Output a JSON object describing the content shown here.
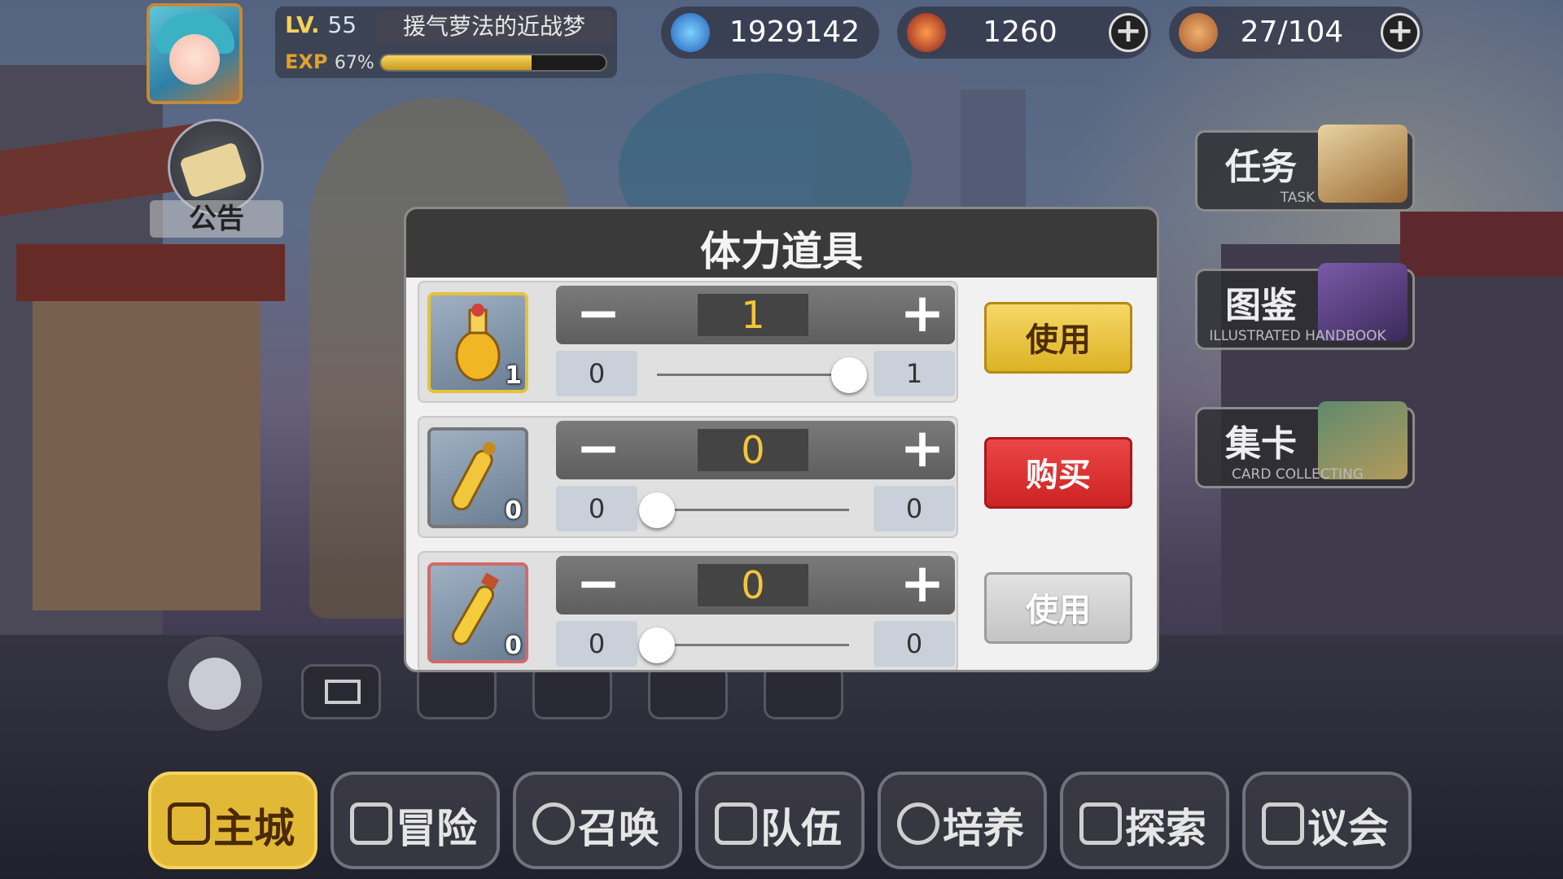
{
  "hud": {
    "level_label": "LV.",
    "level": "55",
    "player_name": "援气萝法的近战梦",
    "exp_label": "EXP",
    "exp_percent": "67%",
    "exp_progress": 0.67,
    "resources": [
      {
        "icon": "blue-flame-icon",
        "value": "1929142"
      },
      {
        "icon": "red-crystal-icon",
        "value": "1260"
      },
      {
        "icon": "bread-icon",
        "value": "27/104"
      }
    ]
  },
  "notice": {
    "label": "公告"
  },
  "side_buttons": [
    {
      "title": "任务",
      "subtitle": "TASK"
    },
    {
      "title": "图鉴",
      "subtitle": "ILLUSTRATED HANDBOOK"
    },
    {
      "title": "集卡",
      "subtitle": "CARD COLLECTING"
    }
  ],
  "modal": {
    "title": "体力道具",
    "rows": [
      {
        "count": "1",
        "qty": "1",
        "min": "0",
        "max": "1",
        "slider": 1.0,
        "action": "使用"
      },
      {
        "count": "0",
        "qty": "0",
        "min": "0",
        "max": "0",
        "slider": 0.0,
        "action": "购买"
      },
      {
        "count": "0",
        "qty": "0",
        "min": "0",
        "max": "0",
        "slider": 0.0,
        "action": "使用"
      }
    ],
    "minus_symbol": "−",
    "plus_symbol": "+"
  },
  "bottom_nav": [
    {
      "label": "主城",
      "icon": "castle-icon",
      "active": true
    },
    {
      "label": "冒险",
      "icon": "crossed-swords-icon",
      "active": false
    },
    {
      "label": "召唤",
      "icon": "hexagram-icon",
      "active": false
    },
    {
      "label": "队伍",
      "icon": "team-icon",
      "active": false
    },
    {
      "label": "培养",
      "icon": "train-icon",
      "active": false
    },
    {
      "label": "探索",
      "icon": "explore-icon",
      "active": false
    },
    {
      "label": "议会",
      "icon": "council-icon",
      "active": false
    }
  ],
  "quick_icons": [
    "mail-icon",
    "friend-icon",
    "cart-icon",
    "gift-icon",
    "guild-icon"
  ],
  "colors": {
    "accent": "#e2b936",
    "buy": "#d63030",
    "qty": "#f2c63a"
  }
}
